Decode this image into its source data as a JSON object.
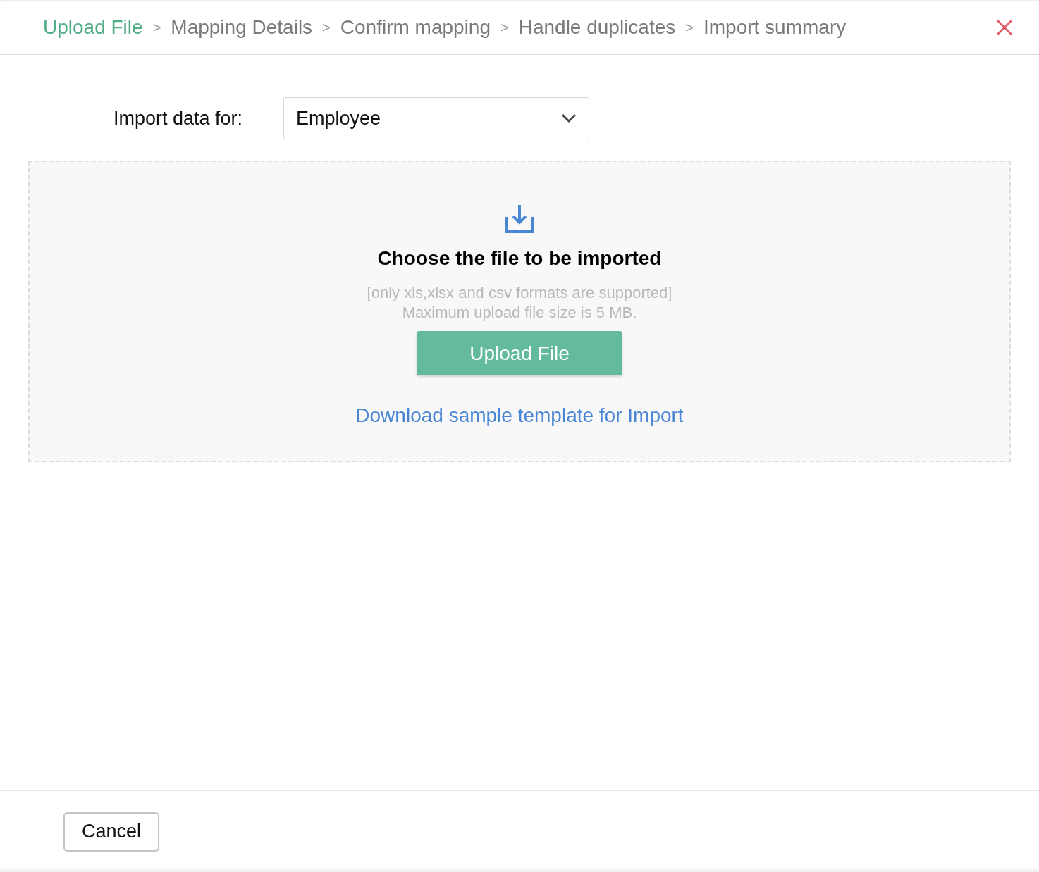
{
  "breadcrumb": [
    {
      "kind": "step",
      "label": "Upload File",
      "selected": true
    },
    {
      "kind": "separator",
      "label": ">"
    },
    {
      "kind": "step",
      "label": "Mapping Details",
      "selected": false
    },
    {
      "kind": "separator",
      "label": ">"
    },
    {
      "kind": "step",
      "label": "Confirm mapping",
      "selected": false
    },
    {
      "kind": "separator",
      "label": ">"
    },
    {
      "kind": "step",
      "label": "Handle duplicates",
      "selected": false
    },
    {
      "kind": "separator",
      "label": ">"
    },
    {
      "kind": "step",
      "label": "Import summary",
      "selected": false
    }
  ],
  "import_for": {
    "label": "Import data for:",
    "value": "Employee"
  },
  "dropzone": {
    "title": "Choose the file to be imported",
    "hint_lines": [
      "[only xls,xlsx and csv formats are supported]",
      "Maximum upload file size is 5 MB."
    ],
    "button": "Upload File",
    "link": "Download sample template for Import"
  },
  "footer": {
    "cancel": "Cancel"
  }
}
